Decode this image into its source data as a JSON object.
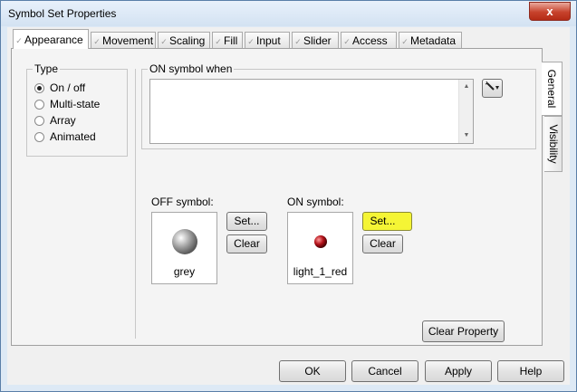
{
  "window": {
    "title": "Symbol Set Properties",
    "close_glyph": "x"
  },
  "tabs": [
    {
      "label": "Appearance",
      "active": true
    },
    {
      "label": "Movement"
    },
    {
      "label": "Scaling"
    },
    {
      "label": "Fill"
    },
    {
      "label": "Input"
    },
    {
      "label": "Slider"
    },
    {
      "label": "Access"
    },
    {
      "label": "Metadata"
    }
  ],
  "side_tabs": [
    {
      "label": "General",
      "active": true
    },
    {
      "label": "Visibility"
    }
  ],
  "type_group": {
    "legend": "Type",
    "options": [
      {
        "label": "On / off",
        "checked": true
      },
      {
        "label": "Multi-state",
        "checked": false
      },
      {
        "label": "Array",
        "checked": false
      },
      {
        "label": "Animated",
        "checked": false
      }
    ]
  },
  "on_when": {
    "legend": "ON symbol when",
    "value": "",
    "wand_icon": "magic-wand-icon"
  },
  "off_symbol": {
    "label": "OFF symbol:",
    "name": "grey",
    "color": "#9a9a9a",
    "set_label": "Set...",
    "clear_label": "Clear"
  },
  "on_symbol": {
    "label": "ON symbol:",
    "name": "light_1_red",
    "color": "#b3121a",
    "set_label": "Set...",
    "clear_label": "Clear",
    "set_highlight": "#f5f535"
  },
  "clear_property_label": "Clear Property",
  "footer": {
    "ok": "OK",
    "cancel": "Cancel",
    "apply": "Apply",
    "help": "Help"
  }
}
